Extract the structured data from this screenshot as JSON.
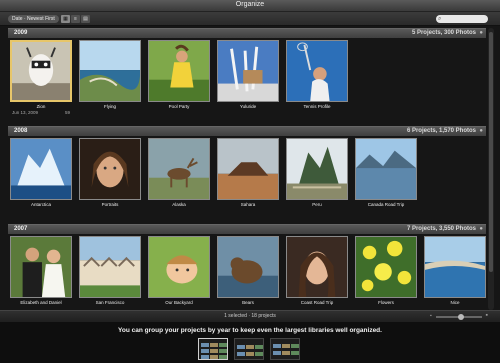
{
  "window": {
    "title": "Organize"
  },
  "toolbar": {
    "sort_label": "Date · Newest First",
    "view_buttons": [
      "grid-view-icon",
      "list-view-icon",
      "projects-view-icon"
    ],
    "search_placeholder": ""
  },
  "groups": [
    {
      "year": "2009",
      "summary": "5 Projects, 300 Photos",
      "projects": [
        {
          "name": "Zion",
          "date": "Jun 13, 2009",
          "count": "59",
          "selected": true,
          "scene": "goat"
        },
        {
          "name": "Flying",
          "scene": "coast"
        },
        {
          "name": "Pool Party",
          "scene": "girl"
        },
        {
          "name": "Yuluride",
          "scene": "fence"
        },
        {
          "name": "Tennis Profile",
          "scene": "tennis"
        }
      ]
    },
    {
      "year": "2008",
      "summary": "6 Projects, 1,570 Photos",
      "projects": [
        {
          "name": "Antarctica",
          "scene": "ice"
        },
        {
          "name": "Portraits",
          "scene": "portrait"
        },
        {
          "name": "Alaska",
          "scene": "elk"
        },
        {
          "name": "Sahara",
          "scene": "desert"
        },
        {
          "name": "Peru",
          "scene": "machu"
        },
        {
          "name": "Canada Road Trip",
          "scene": "lake"
        }
      ]
    },
    {
      "year": "2007",
      "summary": "7 Projects, 3,550 Photos",
      "projects": [
        {
          "name": "Elizabeth and Daniel",
          "scene": "wedding"
        },
        {
          "name": "San Francisco",
          "scene": "houses"
        },
        {
          "name": "Our Backyard",
          "scene": "child"
        },
        {
          "name": "Bears",
          "scene": "bear"
        },
        {
          "name": "Coast Road Trip",
          "scene": "woman"
        },
        {
          "name": "Flowers",
          "scene": "flowers"
        },
        {
          "name": "Nice",
          "scene": "bay"
        }
      ]
    }
  ],
  "status": {
    "text": "1 selected · 18 projects"
  },
  "caption": "You can group your projects by year to keep even the largest libraries well organized.",
  "colors": {
    "selection": "#e7c66a",
    "background": "#161616"
  }
}
